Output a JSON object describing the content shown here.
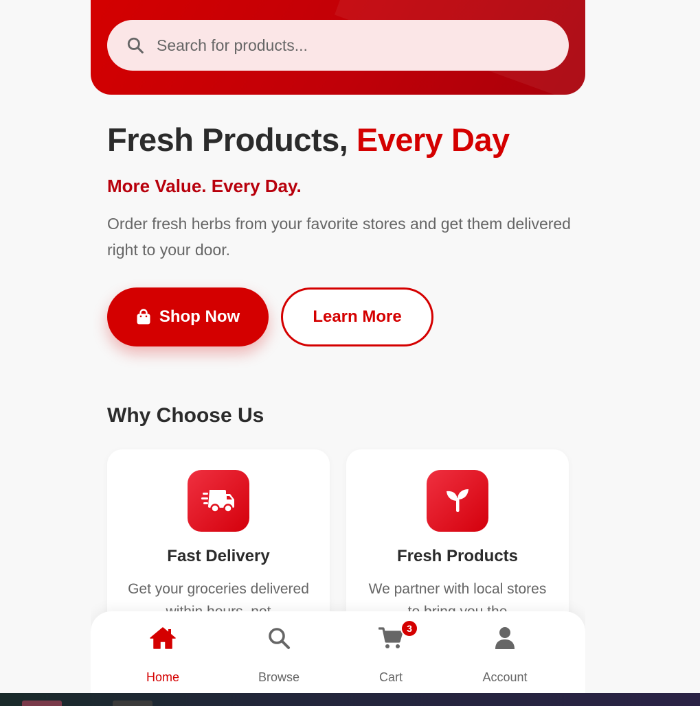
{
  "search": {
    "placeholder": "Search for products..."
  },
  "hero": {
    "title_main": "Fresh Products, ",
    "title_accent": "Every Day",
    "tagline": "More Value. Every Day.",
    "description": "Order fresh herbs from your favorite stores and get them delivered right to your door.",
    "shop_now_label": "Shop Now",
    "learn_more_label": "Learn More"
  },
  "why": {
    "title": "Why Choose Us",
    "cards": [
      {
        "title": "Fast Delivery",
        "text": "Get your groceries delivered within hours, not",
        "icon": "truck-fast-icon"
      },
      {
        "title": "Fresh Products",
        "text": "We partner with local stores to bring you the",
        "icon": "seedling-icon"
      }
    ]
  },
  "nav": {
    "items": [
      {
        "label": "Home",
        "icon": "home-icon",
        "active": true
      },
      {
        "label": "Browse",
        "icon": "search-icon"
      },
      {
        "label": "Cart",
        "icon": "cart-icon",
        "badge": "3"
      },
      {
        "label": "Account",
        "icon": "user-icon"
      }
    ]
  },
  "colors": {
    "accent": "#d40000",
    "accent_dark": "#b8000c",
    "text": "#2b2b2b",
    "muted": "#666666"
  }
}
